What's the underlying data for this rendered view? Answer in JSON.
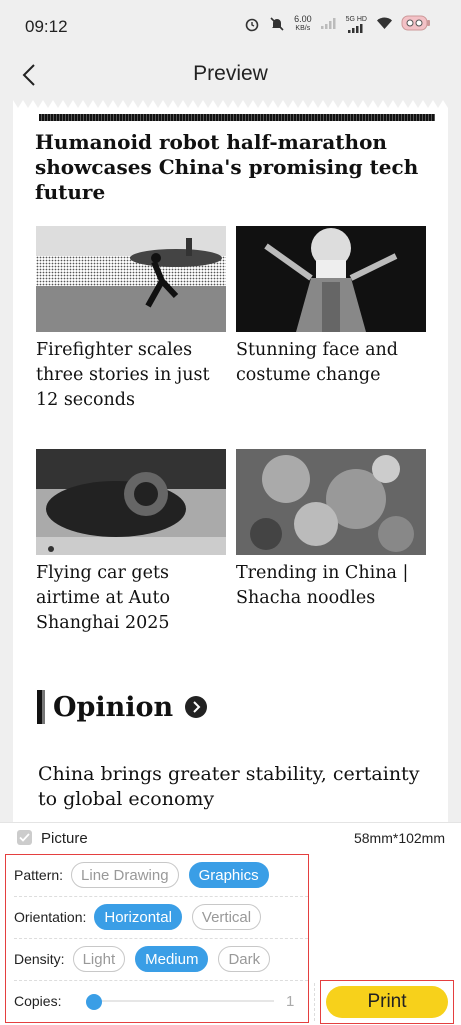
{
  "status_bar": {
    "time": "09:12",
    "net_speed": "6.00",
    "net_unit": "KB/s",
    "network": "5G HD"
  },
  "header": {
    "title": "Preview"
  },
  "preview": {
    "headline": "Humanoid robot half-marathon showcases China's promising tech future",
    "cards": [
      {
        "caption": "Firefighter scales three stories in just 12 seconds"
      },
      {
        "caption": "Stunning face and costume change"
      },
      {
        "caption": "Flying car gets airtime at Auto Shanghai 2025"
      },
      {
        "caption": "Trending in China | Shacha noodles"
      }
    ],
    "section": "Opinion",
    "opinion_headline": "China brings greater stability, certainty to global economy"
  },
  "panel": {
    "picture_label": "Picture",
    "paper_size": "58mm*102mm",
    "pattern": {
      "label": "Pattern:",
      "options": [
        "Line Drawing",
        "Graphics"
      ],
      "selected": "Graphics"
    },
    "orientation": {
      "label": "Orientation:",
      "options": [
        "Horizontal",
        "Vertical"
      ],
      "selected": "Horizontal"
    },
    "density": {
      "label": "Density:",
      "options": [
        "Light",
        "Medium",
        "Dark"
      ],
      "selected": "Medium"
    },
    "copies": {
      "label": "Copies:",
      "value": "1"
    },
    "print_label": "Print"
  },
  "colors": {
    "accent": "#3a9ee6",
    "print_button": "#f7d11b",
    "highlight_box": "#e43f3f"
  }
}
